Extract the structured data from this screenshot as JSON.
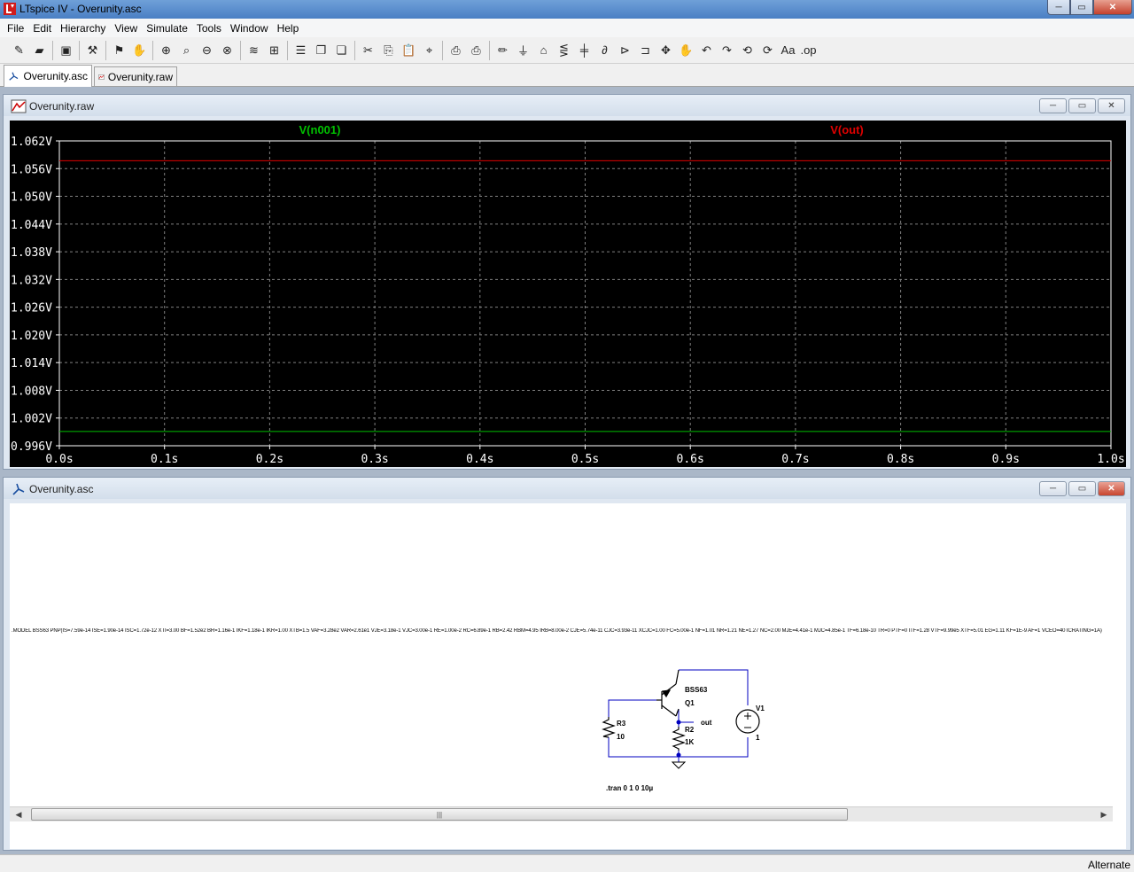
{
  "window": {
    "title": "LTspice IV - Overunity.asc",
    "min_glyph": "─",
    "max_glyph": "▭",
    "close_glyph": "✕"
  },
  "menu": [
    "File",
    "Edit",
    "Hierarchy",
    "View",
    "Simulate",
    "Tools",
    "Window",
    "Help"
  ],
  "toolbar": {
    "groups": [
      [
        {
          "icon": "new-schematic-icon",
          "glyph": "✎"
        },
        {
          "icon": "open-icon",
          "glyph": "▰"
        }
      ],
      [
        {
          "icon": "save-icon",
          "glyph": "▣"
        }
      ],
      [
        {
          "icon": "control-panel-icon",
          "glyph": "⚒"
        }
      ],
      [
        {
          "icon": "run-icon",
          "glyph": "⚑"
        },
        {
          "icon": "halt-icon",
          "glyph": "✋"
        }
      ],
      [
        {
          "icon": "zoom-in-icon",
          "glyph": "⊕"
        },
        {
          "icon": "pan-icon",
          "glyph": "⌕"
        },
        {
          "icon": "zoom-out-icon",
          "glyph": "⊖"
        },
        {
          "icon": "zoom-fit-icon",
          "glyph": "⊗"
        }
      ],
      [
        {
          "icon": "autorange-icon",
          "glyph": "≋"
        },
        {
          "icon": "grid-icon",
          "glyph": "⊞"
        }
      ],
      [
        {
          "icon": "tile-horizontal-icon",
          "glyph": "☰"
        },
        {
          "icon": "cascade-icon",
          "glyph": "❐"
        },
        {
          "icon": "tile-vertical-icon",
          "glyph": "❏"
        }
      ],
      [
        {
          "icon": "cut-icon",
          "glyph": "✂"
        },
        {
          "icon": "copy-icon",
          "glyph": "⎘"
        },
        {
          "icon": "paste-icon",
          "glyph": "📋"
        },
        {
          "icon": "find-icon",
          "glyph": "⌖"
        }
      ],
      [
        {
          "icon": "print-setup-icon",
          "glyph": "⎙"
        },
        {
          "icon": "print-icon",
          "glyph": "⎙"
        }
      ],
      [
        {
          "icon": "draw-wire-icon",
          "glyph": "✏"
        },
        {
          "icon": "ground-icon",
          "glyph": "⏚"
        },
        {
          "icon": "label-net-icon",
          "glyph": "⌂"
        },
        {
          "icon": "resistor-icon",
          "glyph": "⋚"
        },
        {
          "icon": "capacitor-icon",
          "glyph": "╪"
        },
        {
          "icon": "inductor-icon",
          "glyph": "∂"
        },
        {
          "icon": "diode-icon",
          "glyph": "⊳"
        },
        {
          "icon": "component-icon",
          "glyph": "⊐"
        },
        {
          "icon": "move-icon",
          "glyph": "✥"
        },
        {
          "icon": "drag-icon",
          "glyph": "✋"
        },
        {
          "icon": "undo-icon",
          "glyph": "↶"
        },
        {
          "icon": "redo-icon",
          "glyph": "↷"
        },
        {
          "icon": "rotate-icon",
          "glyph": "⟲"
        },
        {
          "icon": "mirror-icon",
          "glyph": "⟳"
        },
        {
          "icon": "text-icon",
          "glyph": "Aa"
        },
        {
          "icon": "spice-directive-icon",
          "glyph": ".op"
        }
      ]
    ]
  },
  "tabs": [
    {
      "label": "Overunity.asc",
      "active": true
    },
    {
      "label": "Overunity.raw",
      "active": false
    }
  ],
  "waveform_window": {
    "title": "Overunity.raw",
    "btn_min": "─",
    "btn_max": "▭",
    "btn_close": "✕"
  },
  "chart_data": {
    "type": "line",
    "series": [
      {
        "name": "V(n001)",
        "color": "#00c000",
        "x": [
          0,
          1.0
        ],
        "y": [
          0.99909,
          0.99909
        ]
      },
      {
        "name": "V(out)",
        "color": "#e00000",
        "x": [
          0,
          1.0
        ],
        "y": [
          1.0577,
          1.0577
        ]
      }
    ],
    "xlim": [
      0,
      1.0
    ],
    "ylim": [
      0.996,
      1.062
    ],
    "x_ticks": [
      0,
      0.1,
      0.2,
      0.3,
      0.4,
      0.5,
      0.6,
      0.7,
      0.8,
      0.9,
      1.0
    ],
    "x_tick_labels": [
      "0.0s",
      "0.1s",
      "0.2s",
      "0.3s",
      "0.4s",
      "0.5s",
      "0.6s",
      "0.7s",
      "0.8s",
      "0.9s",
      "1.0s"
    ],
    "y_ticks": [
      1.062,
      1.056,
      1.05,
      1.044,
      1.038,
      1.032,
      1.026,
      1.02,
      1.014,
      1.008,
      1.002,
      0.996
    ],
    "y_tick_labels": [
      "1.062V",
      "1.056V",
      "1.050V",
      "1.044V",
      "1.038V",
      "1.032V",
      "1.026V",
      "1.020V",
      "1.014V",
      "1.008V",
      "1.002V",
      "0.996V"
    ],
    "grid": true,
    "legend": "top",
    "background": "#000000",
    "axis_color": "#ffffff",
    "grid_color": "#808080"
  },
  "schematic_window": {
    "title": "Overunity.asc",
    "btn_min": "─",
    "btn_max": "▭",
    "btn_close": "✕",
    "model_text": ".MODEL BSS63 PNP(IS=7.59e-14 ISE=1.90e-14 ISC=1.72e-12 XTI=3.00 BF=1.52e2 BR=1.16e-1 IKF=1.18e-1 IKR=1.00 XTB=1.5 VAF=3.28e2 VAR=2.61e1 VJE=3.18e-1 VJC=3.00e-1 RE=1.00e-2 RC=6.89e-1 RB=2.42 RBM=4.95 IRB=8.00e-2 CJE=5.74e-11 CJC=3.93e-11 XCJC=1.00 FC=5.00e-1 NF=1.01 NR=1.21 NE=1.27 NC=2.00 MJE=4.41e-1 MJC=4.85e-1 TF=6.18e-10 TR=0 PTF=0 ITF=1.28 VTF=9.99e5 XTF=5.01 EG=1.11 KF=1E-9 AF=1 VCEO=40 ICRATING=1A)",
    "components": {
      "q1_model": "BSS63",
      "q1_name": "Q1",
      "r2_name": "R2",
      "r2_value": "1K",
      "r3_name": "R3",
      "r3_value": "10",
      "v1_name": "V1",
      "v1_value": "1",
      "net_label": "out"
    },
    "directive": ".tran 0 1 0 10µ",
    "scroll_left": "◀",
    "scroll_right": "▶",
    "scroll_grip": "|||"
  },
  "status": {
    "text": "Alternate"
  }
}
